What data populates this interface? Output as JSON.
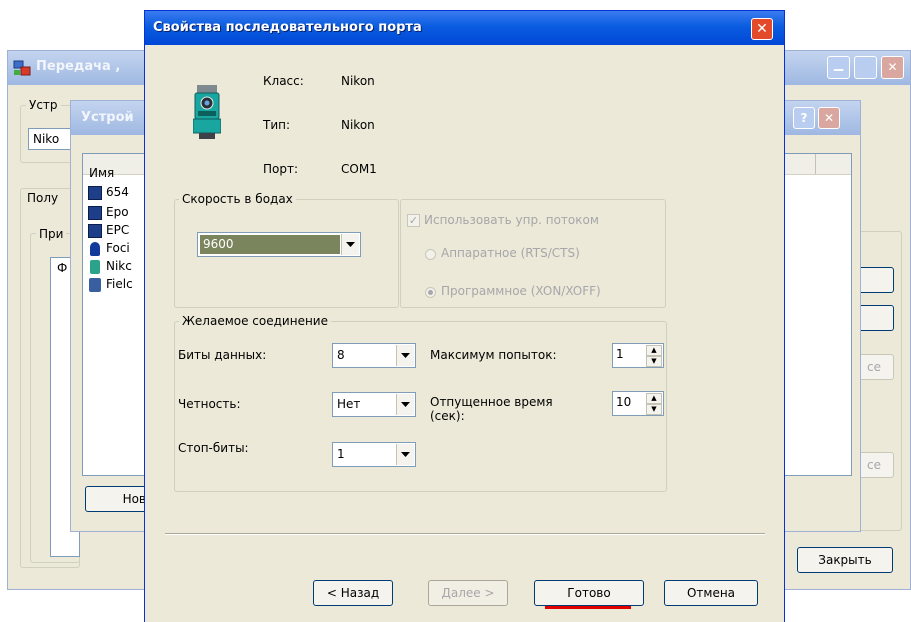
{
  "back_window": {
    "title": "Передача ,",
    "group_device": "Устр",
    "device_value": "Niko",
    "group_receive": "Полу",
    "group_inner": "При",
    "col_short": "Ф",
    "btn_right_3": "се",
    "btn_right_4": "се",
    "close_btn": "Закрыть"
  },
  "middle_window": {
    "title": "Устрой",
    "col_name": "Имя",
    "list": [
      "654",
      "Epo",
      "EPC",
      "Foci",
      "Nikc",
      "Fielc"
    ],
    "btn_new": "Нов"
  },
  "dialog": {
    "title": "Свойства последовательного порта",
    "info": {
      "class_label": "Класс:",
      "class_value": "Nikon",
      "type_label": "Тип:",
      "type_value": "Nikon",
      "port_label": "Порт:",
      "port_value": "COM1"
    },
    "baud": {
      "legend": "Скорость в бодах",
      "value": "9600"
    },
    "flow": {
      "checkbox_label": "Использовать упр. потоком",
      "hardware_label": "Аппаратное (RTS/CTS)",
      "software_label": "Программное (XON/XOFF)"
    },
    "connection": {
      "legend": "Желаемое соединение",
      "data_bits_label": "Биты данных:",
      "data_bits_value": "8",
      "parity_label": "Четность:",
      "parity_value": "Нет",
      "stop_bits_label": "Стоп-биты:",
      "stop_bits_value": "1",
      "max_attempts_label": "Максимум попыток:",
      "max_attempts_value": "1",
      "timeout_label": "Отпущенное время\n(сек):",
      "timeout_value": "10"
    },
    "buttons": {
      "back": "< Назад",
      "next": "Далее >",
      "finish": "Готово",
      "cancel": "Отмена"
    },
    "accent_underline_color": "#e00000"
  }
}
